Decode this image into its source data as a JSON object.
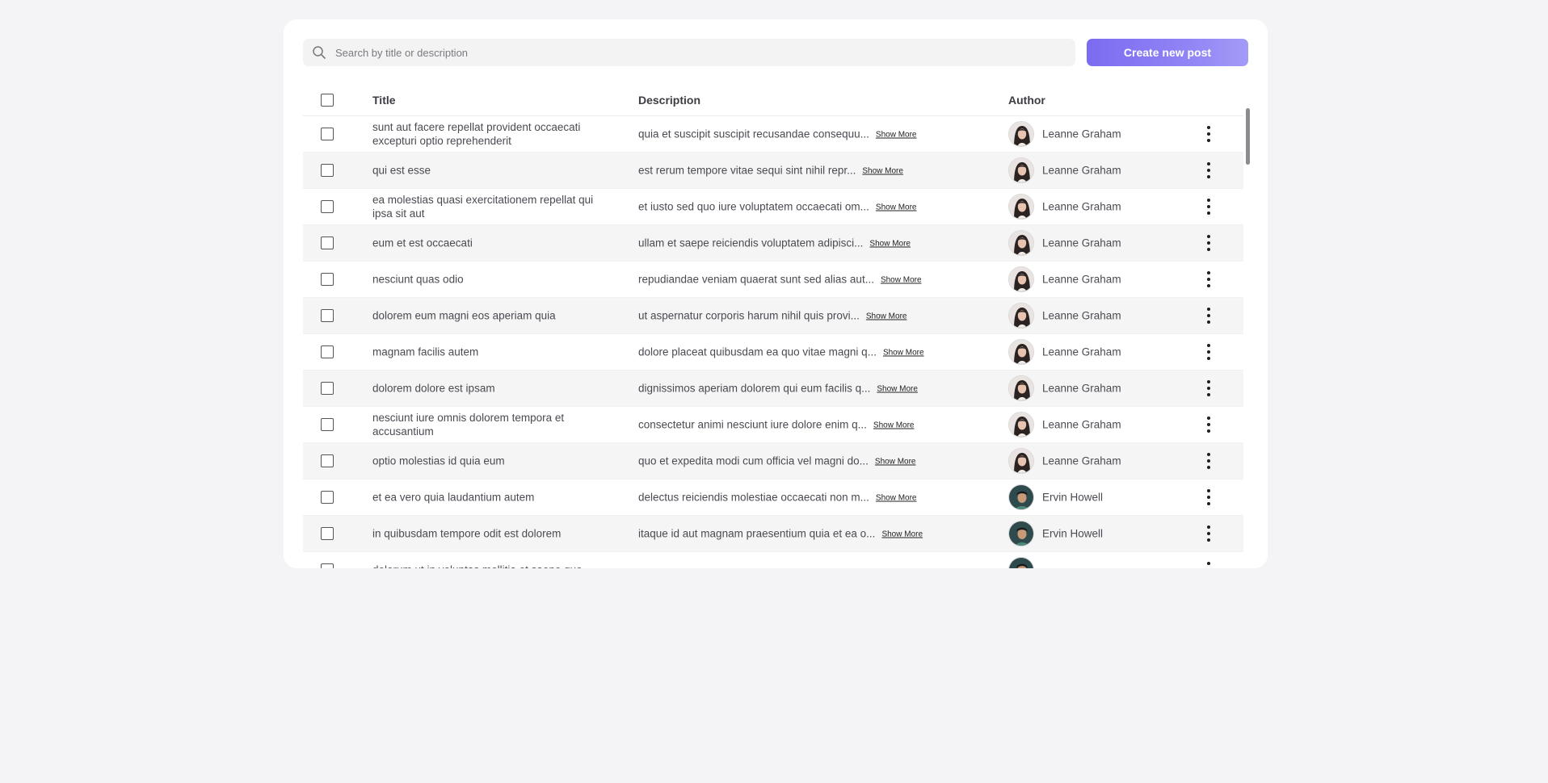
{
  "search": {
    "placeholder": "Search by title or description"
  },
  "toolbar": {
    "create_label": "Create new post"
  },
  "table": {
    "headers": {
      "title": "Title",
      "description": "Description",
      "author": "Author"
    },
    "show_more_label": "Show More",
    "rows": [
      {
        "title": "sunt aut facere repellat provident occaecati excepturi optio reprehenderit",
        "description": "quia et suscipit suscipit recusandae consequu...",
        "author": "Leanne Graham",
        "avatar": "avatar-leanne"
      },
      {
        "title": "qui est esse",
        "description": "est rerum tempore vitae sequi sint nihil repr...",
        "author": "Leanne Graham",
        "avatar": "avatar-leanne"
      },
      {
        "title": "ea molestias quasi exercitationem repellat qui ipsa sit aut",
        "description": "et iusto sed quo iure voluptatem occaecati om...",
        "author": "Leanne Graham",
        "avatar": "avatar-leanne"
      },
      {
        "title": "eum et est occaecati",
        "description": "ullam et saepe reiciendis voluptatem adipisci...",
        "author": "Leanne Graham",
        "avatar": "avatar-leanne"
      },
      {
        "title": "nesciunt quas odio",
        "description": "repudiandae veniam quaerat sunt sed alias aut...",
        "author": "Leanne Graham",
        "avatar": "avatar-leanne"
      },
      {
        "title": "dolorem eum magni eos aperiam quia",
        "description": "ut aspernatur corporis harum nihil quis provi...",
        "author": "Leanne Graham",
        "avatar": "avatar-leanne"
      },
      {
        "title": "magnam facilis autem",
        "description": "dolore placeat quibusdam ea quo vitae magni q...",
        "author": "Leanne Graham",
        "avatar": "avatar-leanne"
      },
      {
        "title": "dolorem dolore est ipsam",
        "description": "dignissimos aperiam dolorem qui eum facilis q...",
        "author": "Leanne Graham",
        "avatar": "avatar-leanne"
      },
      {
        "title": "nesciunt iure omnis dolorem tempora et accusantium",
        "description": "consectetur animi nesciunt iure dolore enim q...",
        "author": "Leanne Graham",
        "avatar": "avatar-leanne"
      },
      {
        "title": "optio molestias id quia eum",
        "description": "quo et expedita modi cum officia vel magni do...",
        "author": "Leanne Graham",
        "avatar": "avatar-leanne"
      },
      {
        "title": "et ea vero quia laudantium autem",
        "description": "delectus reiciendis molestiae occaecati non m...",
        "author": "Ervin Howell",
        "avatar": "avatar-ervin"
      },
      {
        "title": "in quibusdam tempore odit est dolorem",
        "description": "itaque id aut magnam praesentium quia et ea o...",
        "author": "Ervin Howell",
        "avatar": "avatar-ervin"
      },
      {
        "title": "dolorum ut in voluptas mollitia et saepe quo",
        "description": "",
        "author": "",
        "avatar": "avatar-ervin"
      }
    ]
  },
  "icons": {
    "search": "search-icon",
    "row_menu": "more-vertical-icon",
    "checkbox": "checkbox-icon"
  },
  "colors": {
    "accent": "#7b6cf0",
    "accent_light": "#a39bf7",
    "row_alt": "#f5f5f5",
    "background": "#f4f4f6"
  }
}
